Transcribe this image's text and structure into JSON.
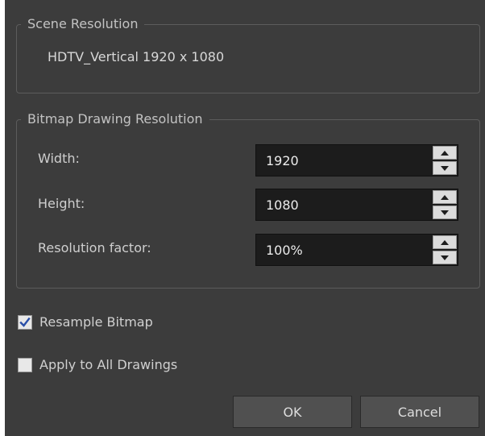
{
  "scene_resolution": {
    "title": "Scene Resolution",
    "value": "HDTV_Vertical  1920 x 1080"
  },
  "bitmap_resolution": {
    "title": "Bitmap Drawing Resolution",
    "fields": [
      {
        "label": "Width:",
        "value": "1920"
      },
      {
        "label": "Height:",
        "value": "1080"
      },
      {
        "label": "Resolution factor:",
        "value": "100%"
      }
    ]
  },
  "options": {
    "resample_bitmap": {
      "label": "Resample Bitmap",
      "checked": true
    },
    "apply_all": {
      "label": "Apply to All Drawings",
      "checked": false
    }
  },
  "buttons": {
    "ok": "OK",
    "cancel": "Cancel"
  },
  "colors": {
    "dialog_bg": "#3c3c3c",
    "field_bg": "#1c1c1c",
    "button_bg": "#505050",
    "check_accent": "#2a4fa8"
  }
}
